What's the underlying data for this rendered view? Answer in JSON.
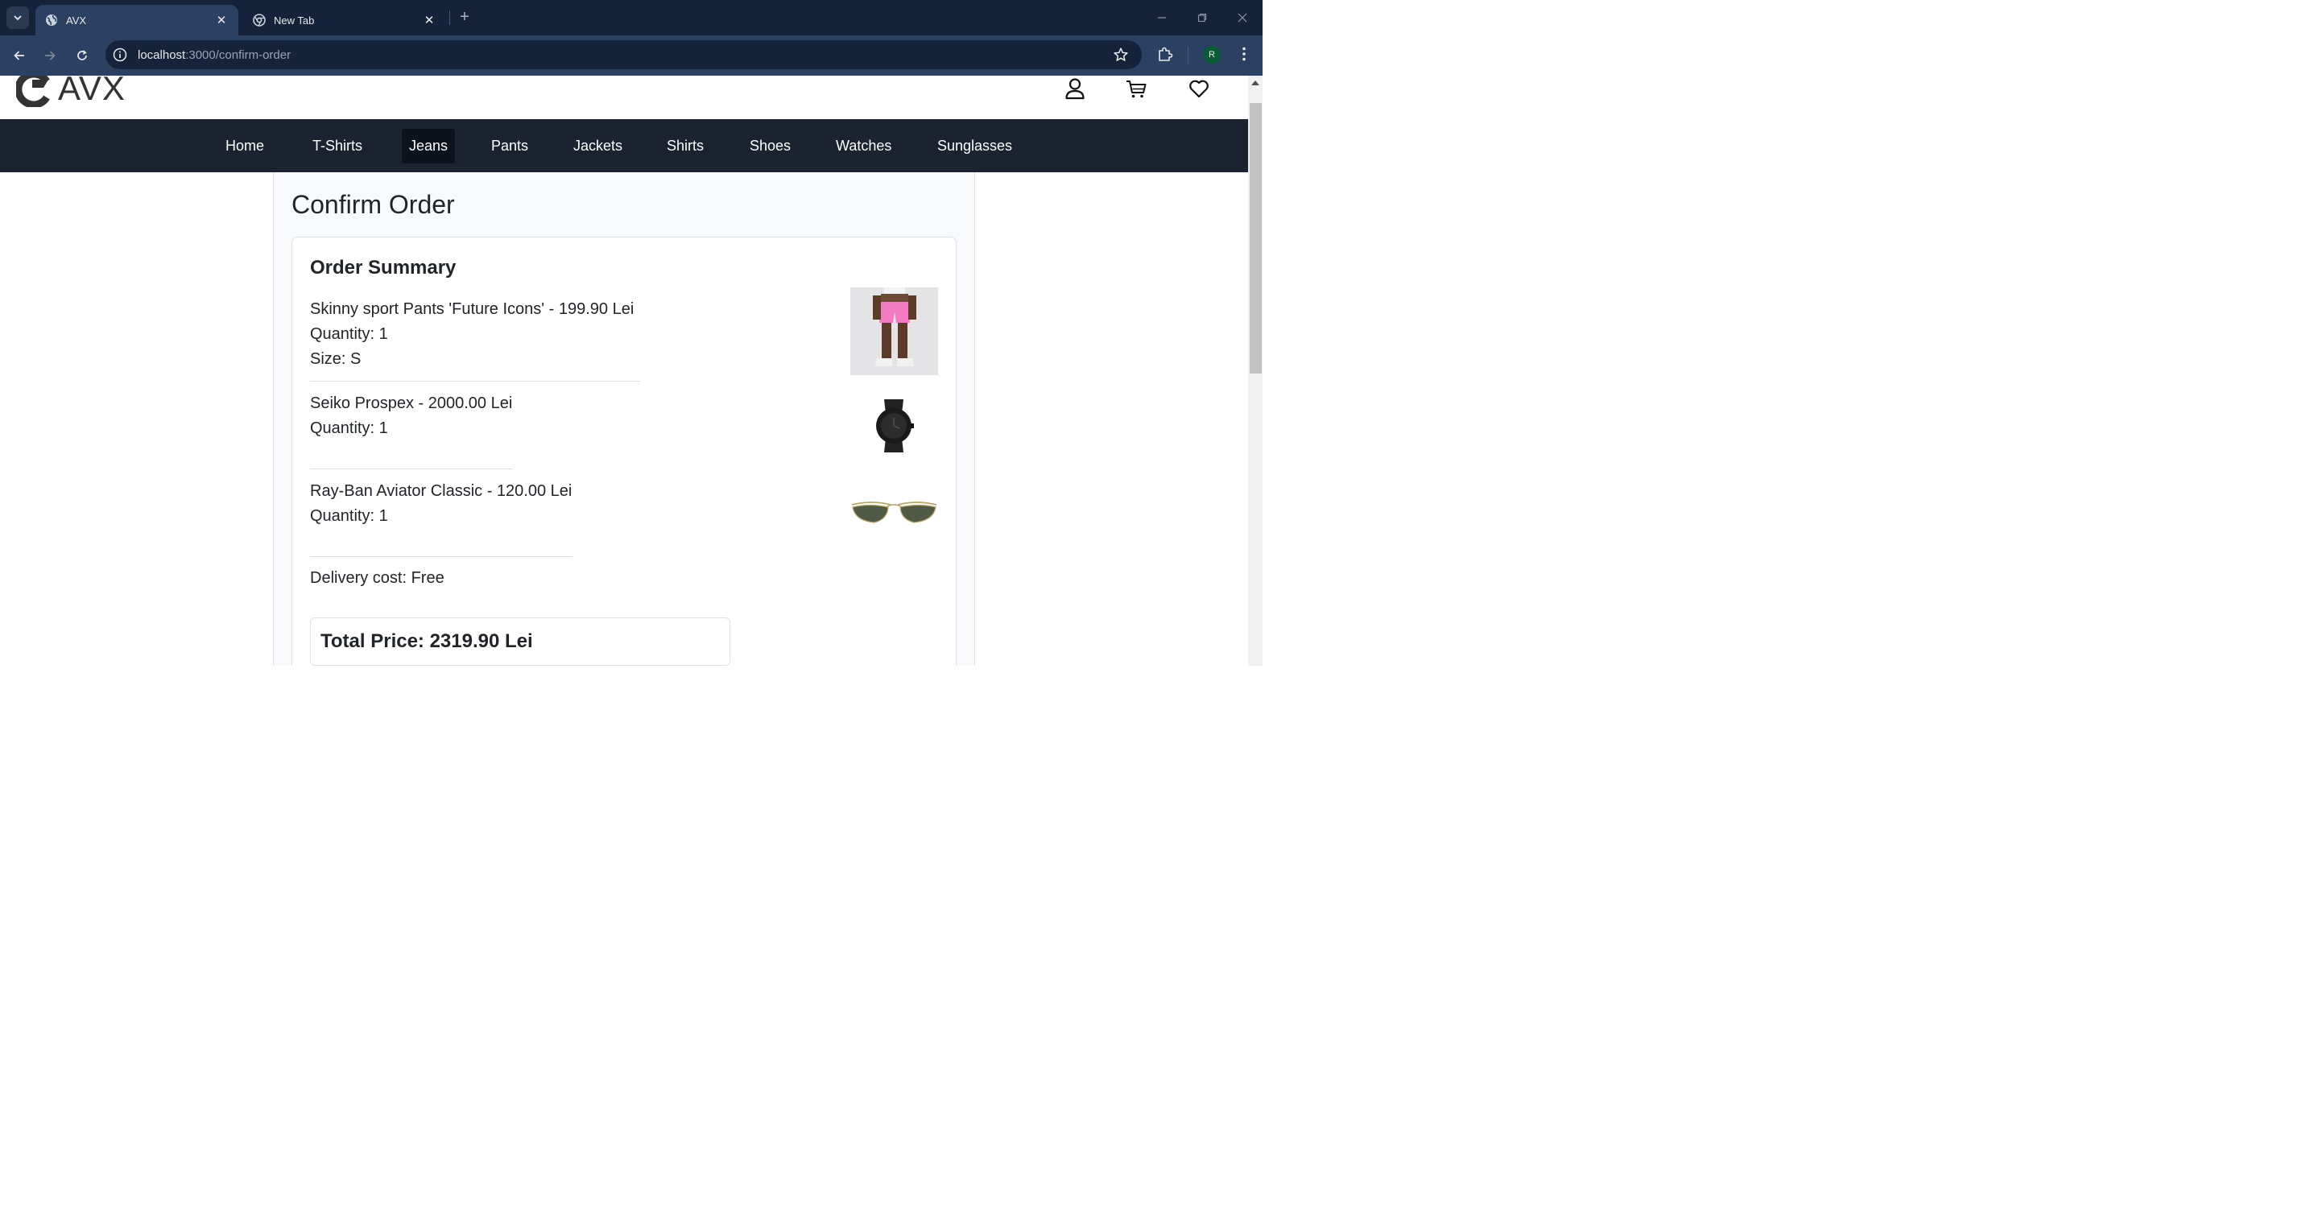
{
  "browser": {
    "tabs": [
      {
        "title": "AVX",
        "active": true
      },
      {
        "title": "New Tab",
        "active": false
      }
    ],
    "url_host": "localhost",
    "url_path": ":3000/confirm-order",
    "profile_initial": "R"
  },
  "site": {
    "logo_text": "AVX",
    "nav": [
      "Home",
      "T-Shirts",
      "Jeans",
      "Pants",
      "Jackets",
      "Shirts",
      "Shoes",
      "Watches",
      "Sunglasses"
    ],
    "active_nav": "Jeans"
  },
  "page": {
    "title": "Confirm Order",
    "summary_title": "Order Summary",
    "items": [
      {
        "line1": "Skinny sport Pants 'Future Icons' - 199.90 Lei",
        "line2": "Quantity: 1",
        "line3": "Size: S",
        "image": "pink-shorts-photo"
      },
      {
        "line1": "Seiko Prospex - 2000.00 Lei",
        "line2": "Quantity: 1",
        "image": "black-watch-photo"
      },
      {
        "line1": "Ray-Ban Aviator Classic - 120.00 Lei",
        "line2": "Quantity: 1",
        "image": "aviator-sunglasses-photo"
      }
    ],
    "delivery": "Delivery cost: Free",
    "total": "Total Price: 2319.90 Lei"
  },
  "colors": {
    "tabbar": "#142339",
    "toolbar": "#2b4162",
    "navbar": "#1b2330",
    "nav_active": "#0d131d"
  }
}
